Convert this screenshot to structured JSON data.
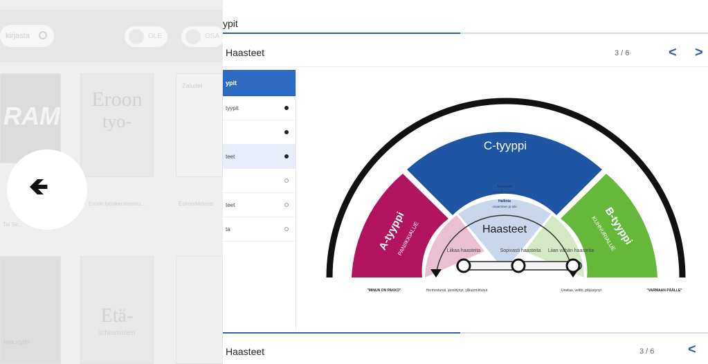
{
  "background": {
    "search_placeholder": "kirjasta",
    "pill_1": "OLE",
    "pill_2": "OSA",
    "books": [
      {
        "title": "RAM",
        "caption": "Tai Se..."
      },
      {
        "title": "Eroon",
        "subtitle": "tyo-",
        "caption": "Eroon tyoskentelemu..."
      },
      {
        "title": "Zaludel",
        "caption": "Esimerkkiteos"
      },
      {
        "title": "",
        "caption": "mia stylin"
      },
      {
        "title": "Etä-",
        "subtitle": "ichtaminen",
        "caption": ""
      },
      {
        "title": "",
        "caption": ""
      }
    ]
  },
  "main": {
    "top_title": "ypit",
    "progress_fraction": 0.49,
    "header_title": "Haasteet",
    "counter": "3 / 6",
    "prev_label": "<",
    "next_label": ">"
  },
  "sidebar": {
    "heading": "ypit",
    "items": [
      {
        "label": "tyypit",
        "status": "done"
      },
      {
        "label": "",
        "status": "done"
      },
      {
        "label": "teet",
        "status": "done",
        "active": true
      },
      {
        "label": "",
        "status": "todo"
      },
      {
        "label": "teet",
        "status": "todo"
      },
      {
        "label": "ta",
        "status": "todo"
      }
    ]
  },
  "diagram": {
    "c_label": "C-tyyppi",
    "a_label": "A-tyyppi",
    "a_sub": "PANIIKKIALUE",
    "b_label": "B-tyyppi",
    "b_sub": "KUHNURIALUE",
    "center": "Haasteet",
    "inner_1": "Haasteet",
    "inner_1b": "koko ja innostus",
    "inner_2": "Hallinta",
    "inner_2b": "osaaminen ja tuki",
    "low_left": "Liikaa haasteita",
    "low_mid": "Sopivasti haasteita",
    "low_right": "Liian vähän haasteita",
    "foot_1": "\"MINUN ON PAKKO\"",
    "foot_2": "Hermostunut, jännittynyt, ylikuormittunut",
    "foot_3": "Unelias, velttö, pitkästynyt",
    "foot_4": "\"VARMAAN PÄÄLLE\"",
    "colors": {
      "c": "#1f55a3",
      "a": "#b1135f",
      "b": "#66b83a",
      "arc": "#111111"
    }
  },
  "footer": {
    "title": "Haasteet",
    "counter": "3 / 6",
    "prev_label": "<"
  }
}
